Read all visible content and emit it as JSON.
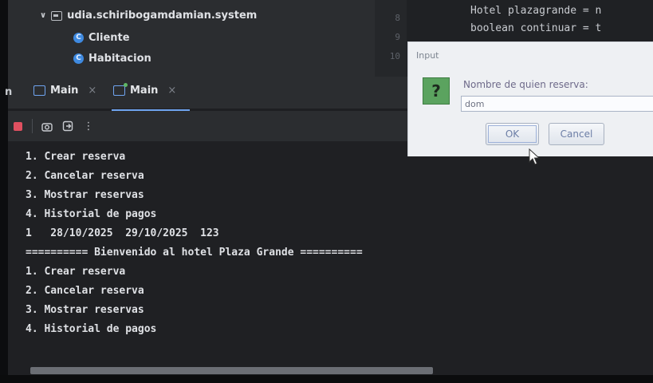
{
  "project": {
    "package": "udia.schiribogamdamian.system",
    "classes": [
      "Cliente",
      "Habitacion"
    ]
  },
  "editor": {
    "line_numbers": [
      "8",
      "9",
      "10"
    ],
    "lines": [
      "Hotel plazagrande = n",
      "boolean continuar = t"
    ]
  },
  "run_tabs": [
    {
      "label": "Main",
      "close": "×"
    },
    {
      "label": "Main",
      "close": "×"
    }
  ],
  "left_edge_char": "n",
  "toolbar": {
    "more": "⋮"
  },
  "console": {
    "lines": [
      "1. Crear reserva",
      "2. Cancelar reserva",
      "3. Mostrar reservas",
      "4. Historial de pagos",
      "1   28/10/2025  29/10/2025  123",
      "========== Bienvenido al hotel Plaza Grande ==========",
      "1. Crear reserva",
      "2. Cancelar reserva",
      "3. Mostrar reservas",
      "4. Historial de pagos"
    ]
  },
  "dialog": {
    "title": "Input",
    "icon_glyph": "?",
    "prompt": "Nombre de quien reserva:",
    "input_value": "dom",
    "ok_label": "OK",
    "cancel_label": "Cancel"
  },
  "colors": {
    "console_bg": "#1f2023",
    "panel_bg": "#2b2d30",
    "accent_blue": "#6fa4f0",
    "stop_red": "#e05060",
    "dialog_bg": "#eef0f3"
  }
}
